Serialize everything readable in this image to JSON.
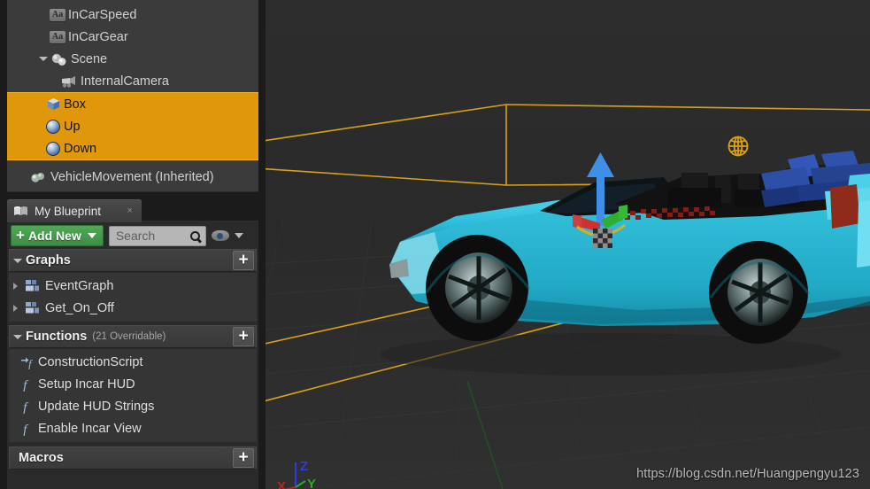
{
  "components_tree": {
    "items": [
      {
        "label": "InCarSpeed",
        "icon": "text-variable-icon",
        "indent": 1,
        "selected": false
      },
      {
        "label": "InCarGear",
        "icon": "text-variable-icon",
        "indent": 1,
        "selected": false
      },
      {
        "label": "Scene",
        "icon": "scene-component-icon",
        "indent": 2,
        "selected": false,
        "expander": "expanded"
      },
      {
        "label": "InternalCamera",
        "icon": "camera-icon",
        "indent": 3,
        "selected": false
      },
      {
        "label": "Box",
        "icon": "box-mesh-icon",
        "indent": 4,
        "selected": true
      },
      {
        "label": "Up",
        "icon": "sphere-mesh-icon",
        "indent": 4,
        "selected": true
      },
      {
        "label": "Down",
        "icon": "sphere-mesh-icon",
        "indent": 4,
        "selected": true
      },
      {
        "label": "VehicleMovement (Inherited)",
        "icon": "vehicle-movement-icon",
        "indent": 0,
        "selected": false
      }
    ]
  },
  "my_blueprint": {
    "tab": {
      "label": "My Blueprint",
      "icon": "blueprint-book-icon",
      "close_label": "×"
    },
    "toolbar": {
      "add_new_label": "Add New",
      "add_new_plus": "+",
      "search_placeholder": "Search",
      "search_value": "",
      "search_icon": "magnifier-icon",
      "eye_icon": "visibility-eye-icon",
      "eye_caret": "chevron-down-icon"
    },
    "sections": [
      {
        "title": "Graphs",
        "note": "",
        "add_label": "+",
        "collapsed": false,
        "items": [
          {
            "label": "EventGraph",
            "icon": "graph-icon",
            "expander": "collapsed"
          },
          {
            "label": "Get_On_Off",
            "icon": "graph-icon",
            "expander": "collapsed"
          }
        ]
      },
      {
        "title": "Functions",
        "note": "(21 Overridable)",
        "add_label": "+",
        "collapsed": false,
        "items": [
          {
            "label": "ConstructionScript",
            "icon": "construction-script-icon"
          },
          {
            "label": "Setup Incar HUD",
            "icon": "function-icon"
          },
          {
            "label": "Update HUD Strings",
            "icon": "function-icon"
          },
          {
            "label": "Enable Incar View",
            "icon": "function-icon"
          }
        ]
      },
      {
        "title": "Macros",
        "note": "",
        "add_label": "+",
        "collapsed": true,
        "items": []
      }
    ]
  },
  "viewport": {
    "watermark": "https://blog.csdn.net/Huangpengyu123",
    "axis_labels": {
      "x": "X",
      "y": "Y",
      "z": "Z"
    },
    "gizmo": {
      "type": "translate-gizmo",
      "up_axis_color": "#3d8fe8"
    },
    "pivot_icon": "world-sphere-icon",
    "colors": {
      "background": "#2b2b2b",
      "selection_outline": "#d9a018",
      "vehicle_body": "#2bb8d6",
      "tail_light": "#8f2b1a",
      "grid": "#343434",
      "axis_x": "#c02020",
      "axis_y": "#22b022",
      "axis_z": "#2b3ee0"
    }
  },
  "theme": {
    "panel_bg": "#2a2a2a",
    "tree_bg": "#3b3b3b",
    "selection_orange": "#e0980a",
    "add_new_green": "#4faa55"
  }
}
